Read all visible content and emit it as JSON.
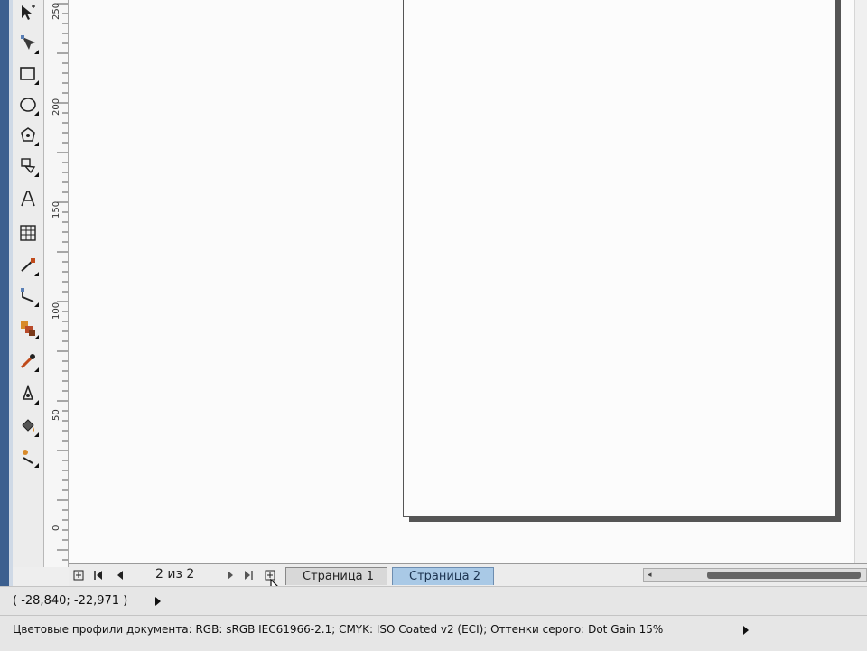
{
  "toolbox": {
    "tools": [
      {
        "name": "pick-tool-icon"
      },
      {
        "name": "shape-tool-icon"
      },
      {
        "name": "rectangle-tool-icon"
      },
      {
        "name": "ellipse-tool-icon"
      },
      {
        "name": "polygon-tool-icon"
      },
      {
        "name": "basic-shapes-tool-icon"
      },
      {
        "name": "text-tool-icon"
      },
      {
        "name": "table-tool-icon"
      },
      {
        "name": "dimension-tool-icon"
      },
      {
        "name": "connector-tool-icon"
      },
      {
        "name": "blend-tool-icon"
      },
      {
        "name": "eyedropper-tool-icon"
      },
      {
        "name": "outline-tool-icon"
      },
      {
        "name": "fill-tool-icon"
      },
      {
        "name": "interactive-fill-tool-icon"
      }
    ]
  },
  "ruler": {
    "labels": [
      "250",
      "200",
      "150",
      "100",
      "50",
      "0"
    ]
  },
  "navigator": {
    "page_count": "2 из 2",
    "tabs": [
      {
        "label": "Страница 1",
        "active": false
      },
      {
        "label": "Страница 2",
        "active": true
      }
    ]
  },
  "status": {
    "coordinates": "( -28,840; -22,971 )",
    "color_profiles": "Цветовые профили документа: RGB: sRGB IEC61966-2.1; CMYK: ISO Coated v2 (ECI); Оттенки серого: Dot Gain 15%"
  },
  "colors": {
    "window_frame": "#3c5f8f",
    "active_tab": "#a9c9e6",
    "page_shadow": "#555555"
  }
}
